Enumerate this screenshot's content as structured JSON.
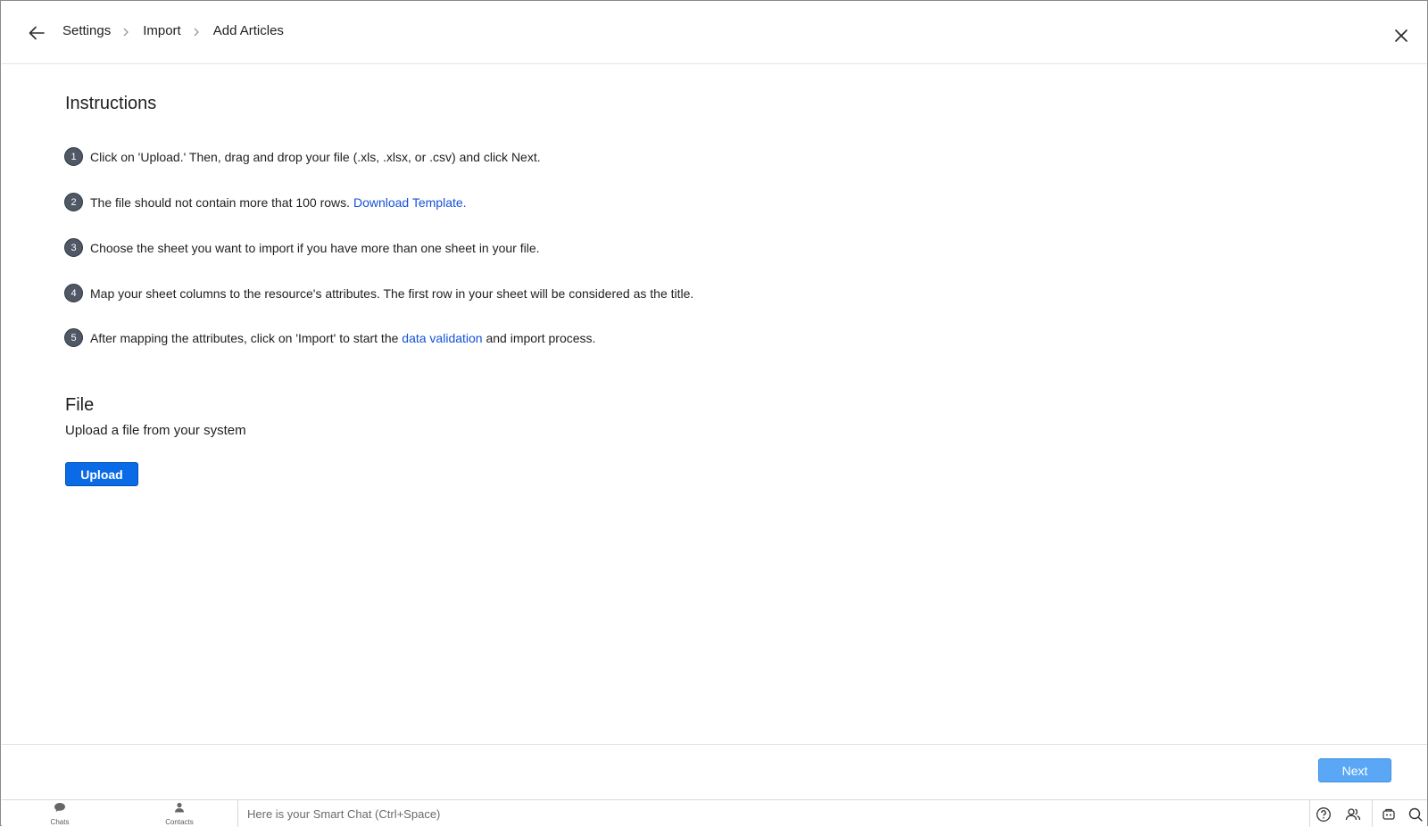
{
  "header": {
    "breadcrumb": [
      "Settings",
      "Import",
      "Add Articles"
    ]
  },
  "instructions": {
    "title": "Instructions",
    "steps": [
      {
        "num": "1",
        "text": "Click on 'Upload.' Then, drag and drop your file (.xls, .xlsx, or .csv) and click Next."
      },
      {
        "num": "2",
        "text": "The file should not contain more that 100 rows. ",
        "link": "Download Template."
      },
      {
        "num": "3",
        "text": "Choose the sheet you want to import if you have more than one sheet in your file."
      },
      {
        "num": "4",
        "text": "Map your sheet columns to the resource's attributes. The first row in your sheet will be considered as the title."
      },
      {
        "num": "5",
        "text_before": "After mapping the attributes, click on 'Import' to start the ",
        "link": "data validation",
        "text_after": " and import process."
      }
    ]
  },
  "file": {
    "title": "File",
    "subtitle": "Upload a file from your system",
    "upload_label": "Upload"
  },
  "footer": {
    "next_label": "Next"
  },
  "bottombar": {
    "chats_label": "Chats",
    "contacts_label": "Contacts",
    "smart_chat_placeholder": "Here is your Smart Chat (Ctrl+Space)",
    "icons": [
      "help-icon",
      "users-icon",
      "bot-icon",
      "search-icon"
    ]
  },
  "colors": {
    "link": "#1451d8",
    "primary_button": "#0b6ae6",
    "next_button": "#5aa8f5",
    "step_badge": "#4f5864"
  }
}
